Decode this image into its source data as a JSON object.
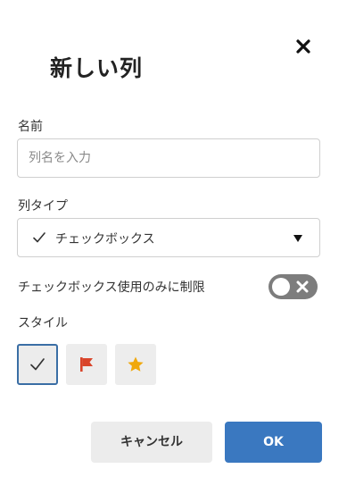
{
  "dialog": {
    "title": "新しい列",
    "close_icon": "close-icon"
  },
  "name_field": {
    "label": "名前",
    "value": "",
    "placeholder": "列名を入力"
  },
  "type_field": {
    "label": "列タイプ",
    "selected_value": "チェックボックス",
    "selected_icon": "checkmark-icon",
    "dropdown_icon": "caret-down-icon"
  },
  "restrict_toggle": {
    "label": "チェックボックス使用のみに制限",
    "state": "off",
    "color": "#7d7d7d"
  },
  "style_section": {
    "label": "スタイル",
    "options": [
      {
        "icon": "checkmark-icon",
        "selected": true
      },
      {
        "icon": "flag-icon",
        "selected": false,
        "color": "#d9452b"
      },
      {
        "icon": "star-icon",
        "selected": false,
        "color": "#f0a80b"
      }
    ]
  },
  "actions": {
    "cancel_label": "キャンセル",
    "ok_label": "OK",
    "ok_color": "#3a78c0"
  }
}
